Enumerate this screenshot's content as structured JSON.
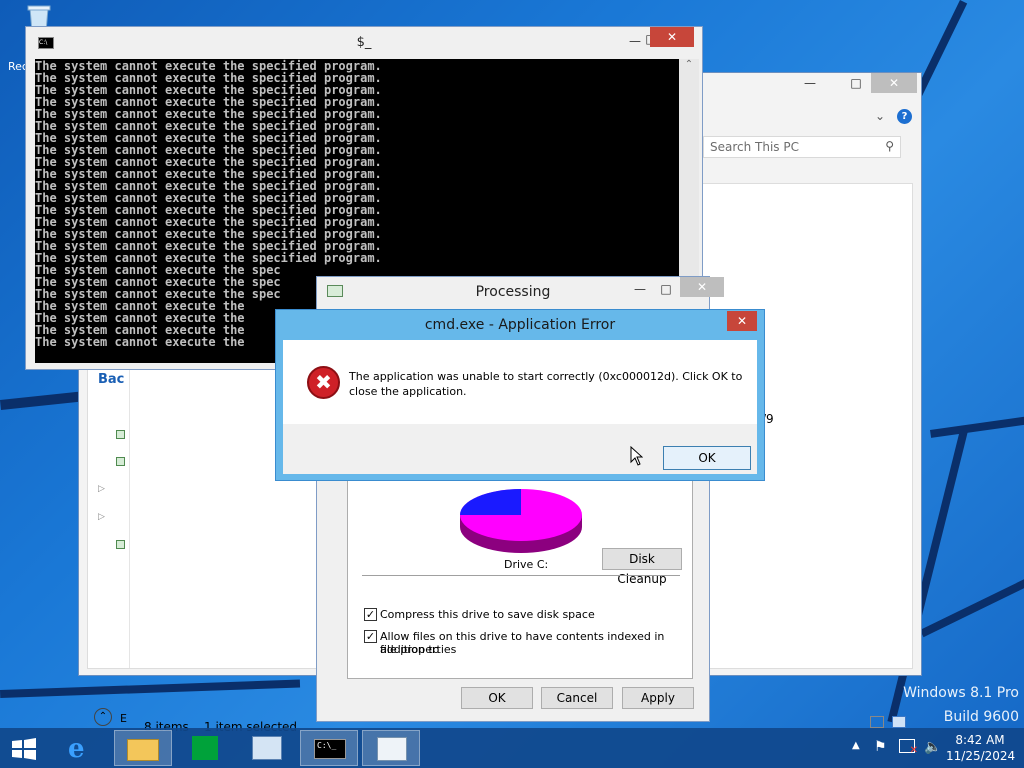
{
  "desktop": {
    "recycle_label": "Rec",
    "watermark_line1": "Windows 8.1 Pro",
    "watermark_line2": "Build 9600"
  },
  "explorer": {
    "search_placeholder": "Search This PC",
    "nav_back": "Bac",
    "status_items": "8 items",
    "status_selected": "1 item selected",
    "partial_label": "/9",
    "nav_partial": "E"
  },
  "cmd": {
    "title": "$_",
    "lines": [
      "The system cannot execute the specified program.",
      "The system cannot execute the specified program.",
      "The system cannot execute the specified program.",
      "The system cannot execute the specified program.",
      "The system cannot execute the specified program.",
      "The system cannot execute the specified program.",
      "The system cannot execute the specified program.",
      "The system cannot execute the specified program.",
      "The system cannot execute the specified program.",
      "The system cannot execute the specified program.",
      "The system cannot execute the specified program.",
      "The system cannot execute the specified program.",
      "The system cannot execute the specified program.",
      "The system cannot execute the specified program.",
      "The system cannot execute the specified program.",
      "The system cannot execute the specified program.",
      "The system cannot execute the specified program.",
      "The system cannot execute the spec",
      "The system cannot execute the spec",
      "The system cannot execute the spec",
      "The system cannot execute the",
      "The system cannot execute the",
      "The system cannot execute the",
      "The system cannot execute the"
    ]
  },
  "props": {
    "title": "Processing",
    "drive_label": "Drive C:",
    "disk_cleanup": "Disk Cleanup",
    "compress_label": "Compress this drive to save disk space",
    "index_label_1": "Allow files on this drive to have contents indexed in addition to",
    "index_label_2": "file properties",
    "ok": "OK",
    "cancel": "Cancel",
    "apply": "Apply"
  },
  "error": {
    "title": "cmd.exe - Application Error",
    "message_1": "The application was unable to start correctly (0xc000012d). Click OK to",
    "message_2": "close the application.",
    "ok": "OK"
  },
  "taskbar": {
    "time": "8:42 AM",
    "date": "11/25/2024"
  },
  "colors": {
    "pie_free": "#ff00ff",
    "pie_used": "#1a1aff",
    "error_frame": "#66b8ea",
    "close_red": "#c7463a"
  }
}
